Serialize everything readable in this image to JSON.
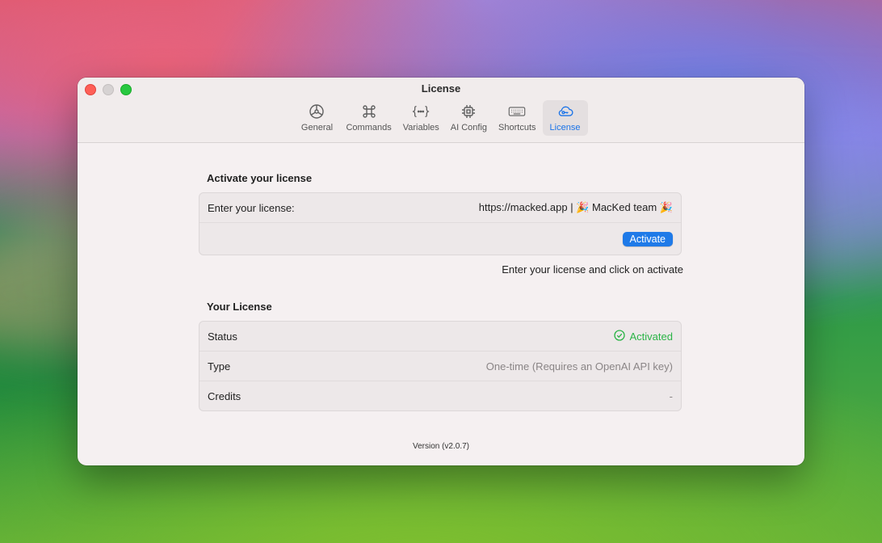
{
  "window": {
    "title": "License"
  },
  "toolbar": {
    "tabs": [
      {
        "label": "General",
        "icon": "settings-gear-icon"
      },
      {
        "label": "Commands",
        "icon": "command-key-icon"
      },
      {
        "label": "Variables",
        "icon": "curly-braces-icon"
      },
      {
        "label": "AI Config",
        "icon": "chip-icon"
      },
      {
        "label": "Shortcuts",
        "icon": "keyboard-icon"
      },
      {
        "label": "License",
        "icon": "cloud-key-icon"
      }
    ],
    "active": "License"
  },
  "activate": {
    "title": "Activate your license",
    "field_label": "Enter your license:",
    "field_value": "https://macked.app | 🎉 MacKed team 🎉",
    "button_label": "Activate",
    "hint": "Enter your license and click on activate"
  },
  "license": {
    "title": "Your License",
    "rows": [
      {
        "label": "Status",
        "value": "Activated"
      },
      {
        "label": "Type",
        "value": "One-time (Requires an OpenAI API key)"
      },
      {
        "label": "Credits",
        "value": "-"
      }
    ]
  },
  "footer": {
    "version": "Version (v2.0.7)"
  },
  "colors": {
    "accent": "#1f7ae8",
    "success": "#2ab446"
  }
}
